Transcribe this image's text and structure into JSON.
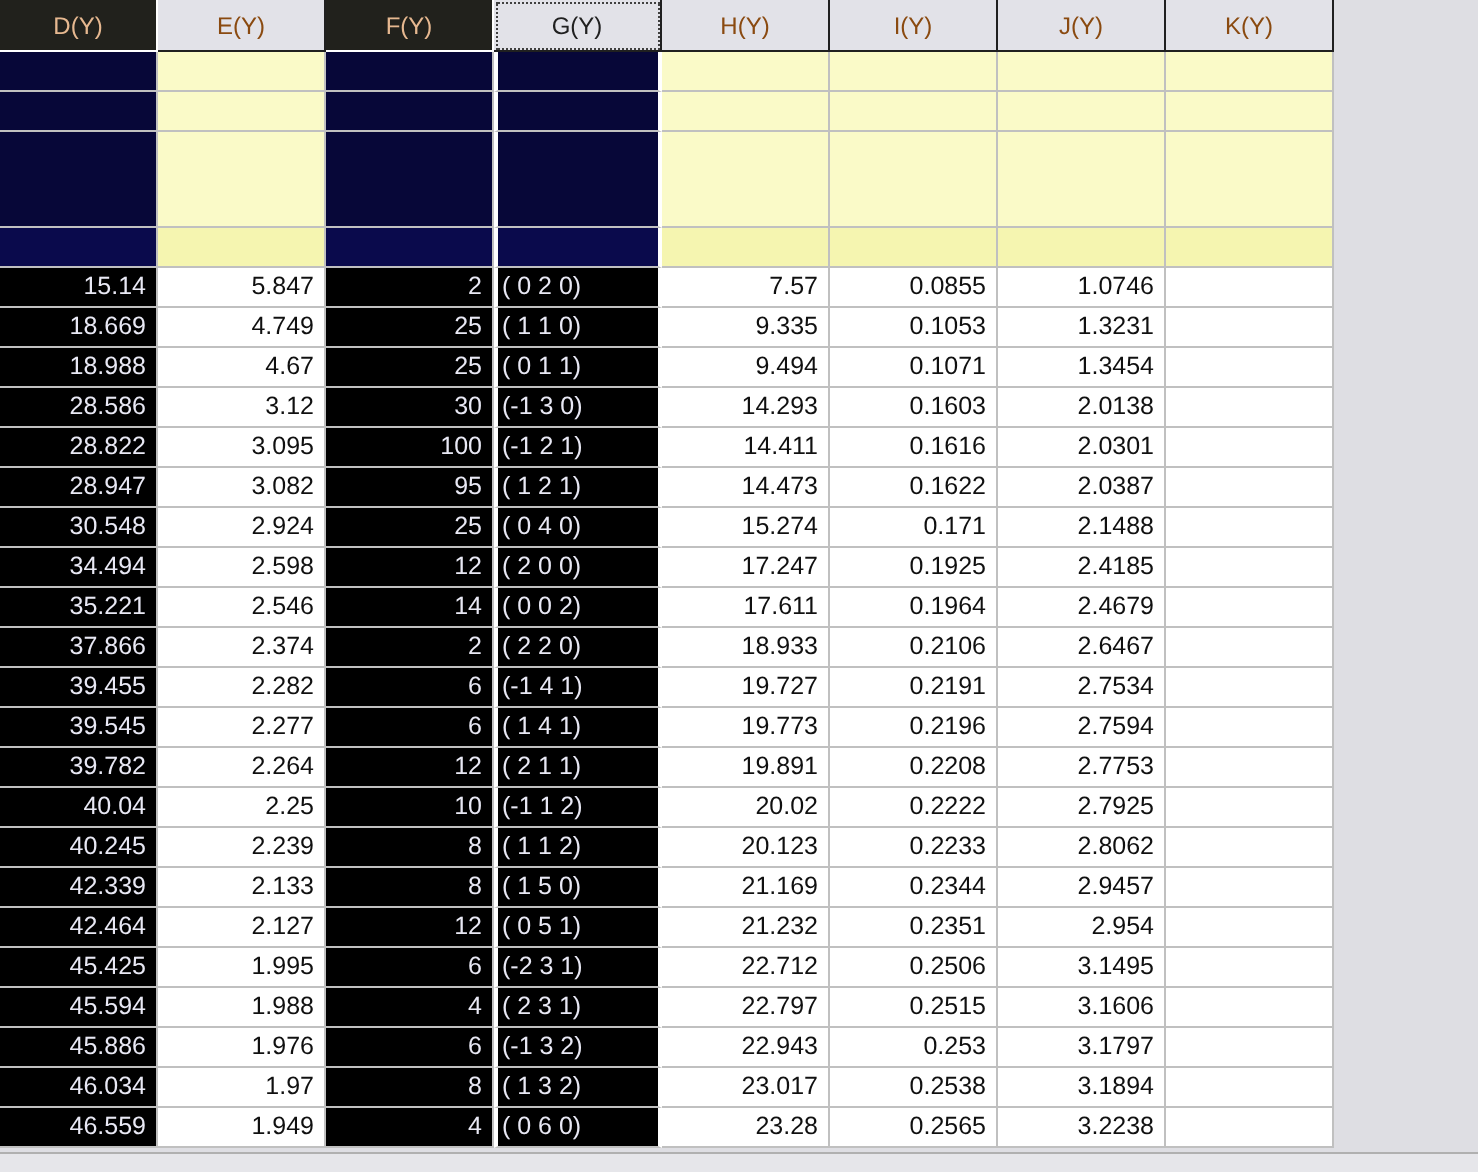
{
  "columns": [
    {
      "header": "D(Y)",
      "selected": true,
      "current": false
    },
    {
      "header": "E(Y)",
      "selected": false,
      "current": false
    },
    {
      "header": "F(Y)",
      "selected": true,
      "current": false
    },
    {
      "header": "G(Y)",
      "selected": true,
      "current": true
    },
    {
      "header": "H(Y)",
      "selected": false,
      "current": false
    },
    {
      "header": "I(Y)",
      "selected": false,
      "current": false
    },
    {
      "header": "J(Y)",
      "selected": false,
      "current": false
    },
    {
      "header": "K(Y)",
      "selected": false,
      "current": false
    }
  ],
  "rows": [
    [
      "15.14",
      "5.847",
      "2",
      "( 0 2 0)",
      "7.57",
      "0.0855",
      "1.0746"
    ],
    [
      "18.669",
      "4.749",
      "25",
      "( 1 1 0)",
      "9.335",
      "0.1053",
      "1.3231"
    ],
    [
      "18.988",
      "4.67",
      "25",
      "( 0 1 1)",
      "9.494",
      "0.1071",
      "1.3454"
    ],
    [
      "28.586",
      "3.12",
      "30",
      "(-1 3 0)",
      "14.293",
      "0.1603",
      "2.0138"
    ],
    [
      "28.822",
      "3.095",
      "100",
      "(-1 2 1)",
      "14.411",
      "0.1616",
      "2.0301"
    ],
    [
      "28.947",
      "3.082",
      "95",
      "( 1 2 1)",
      "14.473",
      "0.1622",
      "2.0387"
    ],
    [
      "30.548",
      "2.924",
      "25",
      "( 0 4 0)",
      "15.274",
      "0.171",
      "2.1488"
    ],
    [
      "34.494",
      "2.598",
      "12",
      "( 2 0 0)",
      "17.247",
      "0.1925",
      "2.4185"
    ],
    [
      "35.221",
      "2.546",
      "14",
      "( 0 0 2)",
      "17.611",
      "0.1964",
      "2.4679"
    ],
    [
      "37.866",
      "2.374",
      "2",
      "( 2 2 0)",
      "18.933",
      "0.2106",
      "2.6467"
    ],
    [
      "39.455",
      "2.282",
      "6",
      "(-1 4 1)",
      "19.727",
      "0.2191",
      "2.7534"
    ],
    [
      "39.545",
      "2.277",
      "6",
      "( 1 4 1)",
      "19.773",
      "0.2196",
      "2.7594"
    ],
    [
      "39.782",
      "2.264",
      "12",
      "( 2 1 1)",
      "19.891",
      "0.2208",
      "2.7753"
    ],
    [
      "40.04",
      "2.25",
      "10",
      "(-1 1 2)",
      "20.02",
      "0.2222",
      "2.7925"
    ],
    [
      "40.245",
      "2.239",
      "8",
      "( 1 1 2)",
      "20.123",
      "0.2233",
      "2.8062"
    ],
    [
      "42.339",
      "2.133",
      "8",
      "( 1 5 0)",
      "21.169",
      "0.2344",
      "2.9457"
    ],
    [
      "42.464",
      "2.127",
      "12",
      "( 0 5 1)",
      "21.232",
      "0.2351",
      "2.954"
    ],
    [
      "45.425",
      "1.995",
      "6",
      "(-2 3 1)",
      "22.712",
      "0.2506",
      "3.1495"
    ],
    [
      "45.594",
      "1.988",
      "4",
      "( 2 3 1)",
      "22.797",
      "0.2515",
      "3.1606"
    ],
    [
      "45.886",
      "1.976",
      "6",
      "(-1 3 2)",
      "22.943",
      "0.253",
      "3.1797"
    ],
    [
      "46.034",
      "1.97",
      "8",
      "( 1 3 2)",
      "23.017",
      "0.2538",
      "3.1894"
    ],
    [
      "46.559",
      "1.949",
      "4",
      "( 0 6 0)",
      "23.28",
      "0.2565",
      "3.2238"
    ]
  ]
}
